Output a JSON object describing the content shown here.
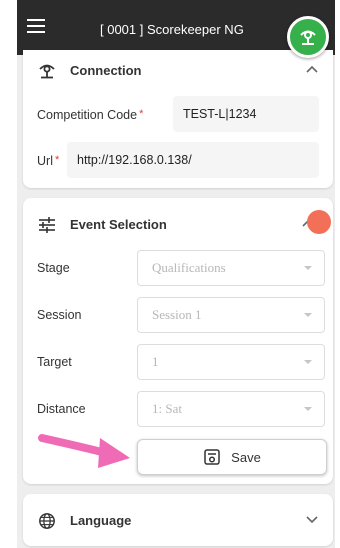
{
  "header": {
    "title": "[ 0001 ] Scorekeeper NG"
  },
  "connection": {
    "title": "Connection",
    "competition_code_label": "Competition Code",
    "competition_code_value": "TEST-L|1234",
    "url_label": "Url",
    "url_value": "http://192.168.0.138/",
    "required_mark": "*"
  },
  "event_selection": {
    "title": "Event Selection",
    "fields": [
      {
        "label": "Stage",
        "value": "Qualifications"
      },
      {
        "label": "Session",
        "value": "Session 1"
      },
      {
        "label": "Target",
        "value": "1"
      },
      {
        "label": "Distance",
        "value": "1: Sat"
      }
    ],
    "save_label": "Save"
  },
  "language": {
    "title": "Language"
  },
  "colors": {
    "topbar": "#2b2b2b",
    "status_ok": "#35b04a",
    "alert_dot": "#f27058",
    "annotation_arrow": "#f06bb5",
    "required": "#e53935"
  },
  "icons": {
    "menu": "menu-icon",
    "connection": "connection-icon",
    "event_selection": "sliders-icon",
    "save": "save-icon",
    "language": "globe-icon"
  }
}
